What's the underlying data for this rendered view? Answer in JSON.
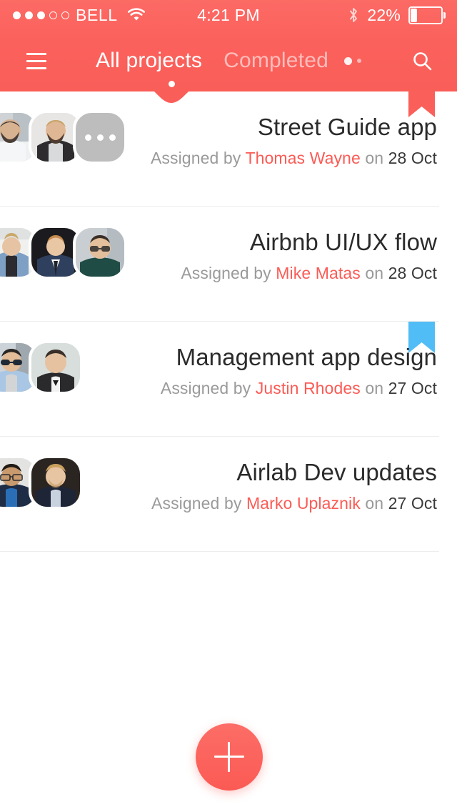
{
  "status_bar": {
    "signal_dots_filled": 3,
    "signal_dots_total": 5,
    "carrier": "BELL",
    "wifi_icon": "wifi-icon",
    "time": "4:21 PM",
    "bluetooth_icon": "bluetooth-icon",
    "battery_percent": "22%",
    "battery_level": 22
  },
  "navbar": {
    "menu_icon": "hamburger-menu-icon",
    "search_icon": "search-icon",
    "tabs": [
      {
        "label": "All projects",
        "active": true
      },
      {
        "label": "Completed",
        "active": false
      }
    ]
  },
  "colors": {
    "accent": "#fb5b55",
    "header_top": "#fc6a65",
    "header_bottom": "#fa5e59",
    "bookmark_red": "#fb5f59",
    "bookmark_blue": "#51bdf6",
    "divider": "#eceded",
    "title_text": "#2b2b2b",
    "muted_text": "#9a9a9a",
    "date_text": "#3a3a3a",
    "avatar_more_bg": "#bdbdbd"
  },
  "list": {
    "assigned_by_label": "Assigned by",
    "on_label": "on",
    "rows": [
      {
        "title": "Street Guide app",
        "assigned_by": "Thomas Wayne",
        "date": "28 Oct",
        "bookmark": "none",
        "avatars": [
          "avatar-photo",
          "avatar-photo",
          "avatar-more"
        ],
        "more_icon": "ellipsis-icon"
      },
      {
        "title": "Airbnb UI/UX flow",
        "assigned_by": "Mike Matas",
        "date": "28 Oct",
        "bookmark": "none",
        "avatars": [
          "avatar-photo",
          "avatar-photo",
          "avatar-photo"
        ]
      },
      {
        "title": "Management app design",
        "assigned_by": "Justin Rhodes",
        "date": "27 Oct",
        "bookmark": "blue",
        "avatars": [
          "avatar-photo",
          "avatar-photo"
        ]
      },
      {
        "title": "Airlab Dev updates",
        "assigned_by": "Marko Uplaznik",
        "date": "27 Oct",
        "bookmark": "none",
        "avatars": [
          "avatar-photo",
          "avatar-photo"
        ]
      }
    ]
  },
  "fab": {
    "icon": "plus-icon",
    "label": "+"
  }
}
